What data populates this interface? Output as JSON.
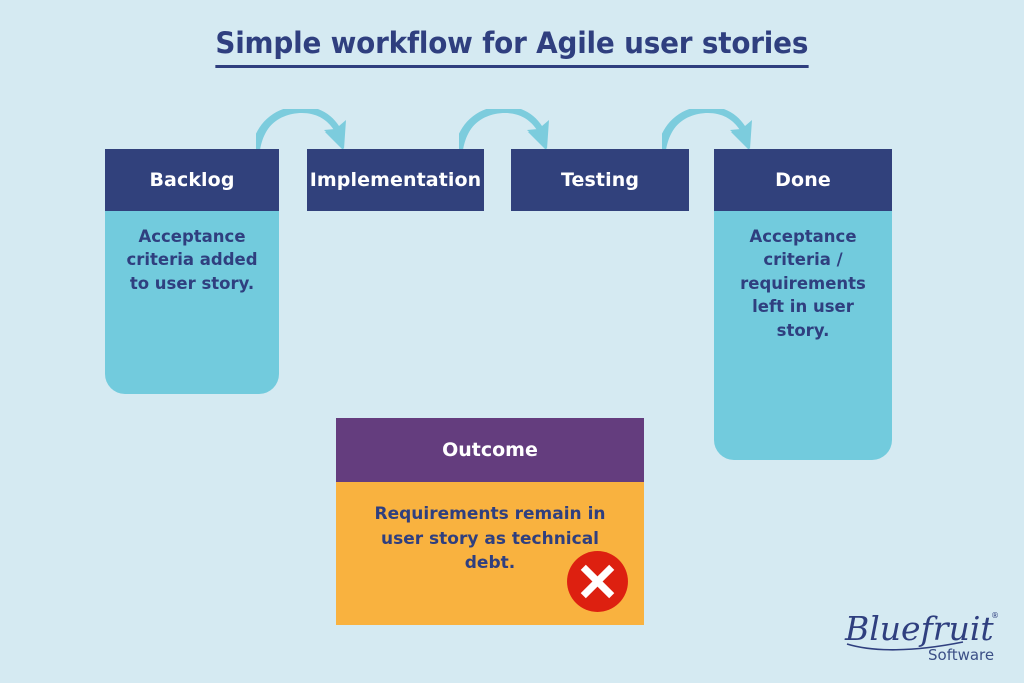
{
  "page": {
    "title": "Simple workflow for Agile user stories",
    "background_color": "#d5eaf2"
  },
  "colors": {
    "navy": "#31417c",
    "title_navy": "#2f3f7f",
    "cyan_body": "#72cbdd",
    "arrow_cyan": "#7cccdd",
    "purple": "#643d7e",
    "orange": "#f9b23f",
    "reject_red": "#dd2010",
    "white": "#ffffff"
  },
  "workflow": {
    "cards": [
      {
        "id": "backlog",
        "header": "Backlog",
        "body": "Acceptance criteria added to user story."
      },
      {
        "id": "implementation",
        "header": "Implementation",
        "body": ""
      },
      {
        "id": "testing",
        "header": "Testing",
        "body": ""
      },
      {
        "id": "done",
        "header": "Done",
        "body": "Acceptance criteria / requirements left in user story."
      }
    ],
    "arrows": [
      {
        "id": "arrow-1",
        "from": "backlog",
        "to": "implementation"
      },
      {
        "id": "arrow-2",
        "from": "implementation",
        "to": "testing"
      },
      {
        "id": "arrow-3",
        "from": "testing",
        "to": "done"
      }
    ]
  },
  "outcome": {
    "header": "Outcome",
    "body": "Requirements remain in user story as technical debt.",
    "icon": "reject-cross-icon"
  },
  "brand": {
    "name": "Bluefruit",
    "tagline": "Software",
    "trademark": "®"
  }
}
